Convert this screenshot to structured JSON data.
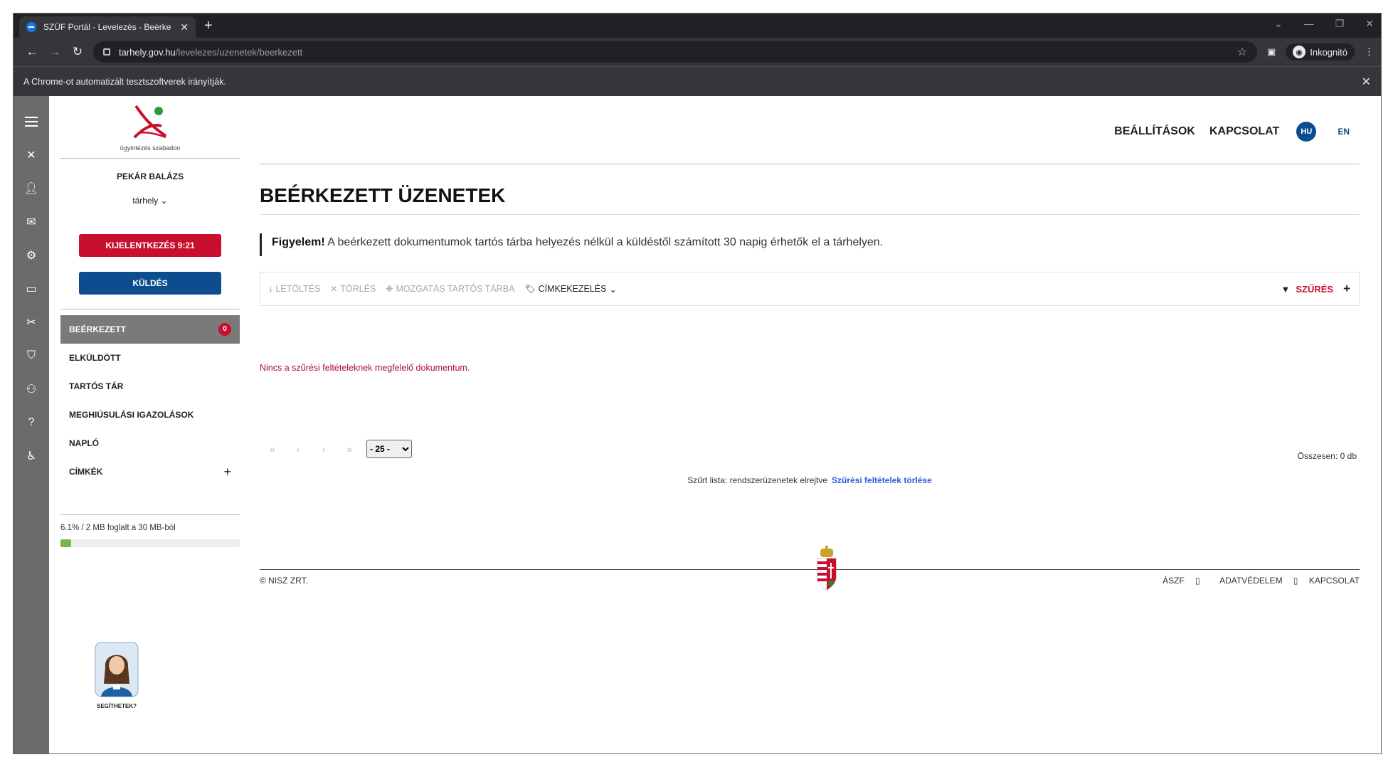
{
  "browser": {
    "tab_title": "SZÜF Portál - Levelezés - Beérke",
    "url_host": "tarhely.gov.hu",
    "url_path": "/levelezes/uzenetek/beerkezett",
    "incognito_label": "Inkognitó",
    "infobar_text": "A Chrome-ot automatizált tesztszoftverek irányítják."
  },
  "sidebar": {
    "logo_tagline": "ügyintézés szabadon",
    "user_name": "PEKÁR BALÁZS",
    "storage_select": "tárhely",
    "logout_label": "KIJELENTKEZÉS 9:21",
    "send_label": "KÜLDÉS",
    "menu": [
      {
        "label": "BEÉRKEZETT",
        "badge": "0"
      },
      {
        "label": "ELKÜLDÖTT"
      },
      {
        "label": "TARTÓS TÁR"
      },
      {
        "label": "MEGHIÚSULÁSI IGAZOLÁSOK"
      },
      {
        "label": "NAPLÓ"
      },
      {
        "label": "CÍMKÉK"
      }
    ],
    "quota_text": "6.1% / 2 MB foglalt a 30 MB-ból",
    "quota_fraction": 0.061,
    "assistant_label": "SEGÍTHETEK?"
  },
  "topnav": {
    "settings": "BEÁLLÍTÁSOK",
    "contact": "KAPCSOLAT",
    "lang_hu": "HU",
    "lang_en": "EN"
  },
  "main": {
    "title": "BEÉRKEZETT ÜZENETEK",
    "notice_bold": "Figyelem!",
    "notice_text": " A beérkezett dokumentumok tartós tárba helyezés nélkül a küldéstől számított 30 napig érhetők el a tárhelyen.",
    "actions": {
      "download": "LETÖLTÉS",
      "delete": "TÖRLÉS",
      "move": "MOZGATÁS TARTÓS TÁRBA",
      "labels": "CÍMKEKEZELÉS",
      "filter": "SZŰRÉS"
    },
    "empty_text": "Nincs a szűrési feltételeknek megfelelő dokumentum.",
    "page_size": "- 25 -",
    "total": "Összesen: 0 db",
    "filtered_text": "Szűrt lista: rendszerüzenetek elrejtve",
    "clear_filters": "Szűrési feltételek törlése"
  },
  "footer": {
    "copyright": "© NISZ ZRT.",
    "aszf": "ÁSZF",
    "privacy": "ADATVÉDELEM",
    "contact": "KAPCSOLAT"
  },
  "colors": {
    "brand_red": "#c8102e",
    "brand_blue": "#0b4d8f",
    "quota_green": "#7ab648"
  }
}
